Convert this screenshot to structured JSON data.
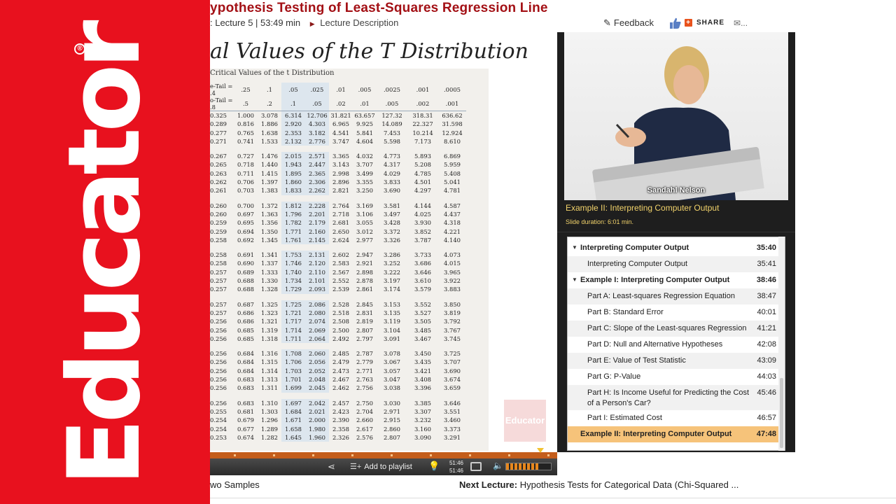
{
  "brand": {
    "name": "Educator",
    "reg_mark": "®"
  },
  "header": {
    "title": "ypothesis Testing of Least-Squares Regression Line",
    "lecture_info": ": Lecture 5 | 53:49 min",
    "lecture_description": "Lecture Description",
    "feedback": "Feedback",
    "share": "SHARE",
    "mail_more": "..."
  },
  "slide": {
    "title": "al Values of the T Distribution",
    "table_caption": "Critical Values of the t Distribution",
    "header_row1": [
      "e-Tail = .4",
      ".25",
      ".1",
      ".05",
      ".025",
      ".01",
      ".005",
      ".0025",
      ".001",
      ".0005"
    ],
    "header_row2": [
      "o-Tail = .8",
      ".5",
      ".2",
      ".1",
      ".05",
      ".02",
      ".01",
      ".005",
      ".002",
      ".001"
    ],
    "groups": [
      [
        [
          "0.325",
          "1.000",
          "3.078",
          "6.314",
          "12.706",
          "31.821",
          "63.657",
          "127.32",
          "318.31",
          "636.62"
        ],
        [
          "0.289",
          "0.816",
          "1.886",
          "2.920",
          "4.303",
          "6.965",
          "9.925",
          "14.089",
          "22.327",
          "31.598"
        ],
        [
          "0.277",
          "0.765",
          "1.638",
          "2.353",
          "3.182",
          "4.541",
          "5.841",
          "7.453",
          "10.214",
          "12.924"
        ],
        [
          "0.271",
          "0.741",
          "1.533",
          "2.132",
          "2.776",
          "3.747",
          "4.604",
          "5.598",
          "7.173",
          "8.610"
        ]
      ],
      [
        [
          "0.267",
          "0.727",
          "1.476",
          "2.015",
          "2.571",
          "3.365",
          "4.032",
          "4.773",
          "5.893",
          "6.869"
        ],
        [
          "0.265",
          "0.718",
          "1.440",
          "1.943",
          "2.447",
          "3.143",
          "3.707",
          "4.317",
          "5.208",
          "5.959"
        ],
        [
          "0.263",
          "0.711",
          "1.415",
          "1.895",
          "2.365",
          "2.998",
          "3.499",
          "4.029",
          "4.785",
          "5.408"
        ],
        [
          "0.262",
          "0.706",
          "1.397",
          "1.860",
          "2.306",
          "2.896",
          "3.355",
          "3.833",
          "4.501",
          "5.041"
        ],
        [
          "0.261",
          "0.703",
          "1.383",
          "1.833",
          "2.262",
          "2.821",
          "3.250",
          "3.690",
          "4.297",
          "4.781"
        ]
      ],
      [
        [
          "0.260",
          "0.700",
          "1.372",
          "1.812",
          "2.228",
          "2.764",
          "3.169",
          "3.581",
          "4.144",
          "4.587"
        ],
        [
          "0.260",
          "0.697",
          "1.363",
          "1.796",
          "2.201",
          "2.718",
          "3.106",
          "3.497",
          "4.025",
          "4.437"
        ],
        [
          "0.259",
          "0.695",
          "1.356",
          "1.782",
          "2.179",
          "2.681",
          "3.055",
          "3.428",
          "3.930",
          "4.318"
        ],
        [
          "0.259",
          "0.694",
          "1.350",
          "1.771",
          "2.160",
          "2.650",
          "3.012",
          "3.372",
          "3.852",
          "4.221"
        ],
        [
          "0.258",
          "0.692",
          "1.345",
          "1.761",
          "2.145",
          "2.624",
          "2.977",
          "3.326",
          "3.787",
          "4.140"
        ]
      ],
      [
        [
          "0.258",
          "0.691",
          "1.341",
          "1.753",
          "2.131",
          "2.602",
          "2.947",
          "3.286",
          "3.733",
          "4.073"
        ],
        [
          "0.258",
          "0.690",
          "1.337",
          "1.746",
          "2.120",
          "2.583",
          "2.921",
          "3.252",
          "3.686",
          "4.015"
        ],
        [
          "0.257",
          "0.689",
          "1.333",
          "1.740",
          "2.110",
          "2.567",
          "2.898",
          "3.222",
          "3.646",
          "3.965"
        ],
        [
          "0.257",
          "0.688",
          "1.330",
          "1.734",
          "2.101",
          "2.552",
          "2.878",
          "3.197",
          "3.610",
          "3.922"
        ],
        [
          "0.257",
          "0.688",
          "1.328",
          "1.729",
          "2.093",
          "2.539",
          "2.861",
          "3.174",
          "3.579",
          "3.883"
        ]
      ],
      [
        [
          "0.257",
          "0.687",
          "1.325",
          "1.725",
          "2.086",
          "2.528",
          "2.845",
          "3.153",
          "3.552",
          "3.850"
        ],
        [
          "0.257",
          "0.686",
          "1.323",
          "1.721",
          "2.080",
          "2.518",
          "2.831",
          "3.135",
          "3.527",
          "3.819"
        ],
        [
          "0.256",
          "0.686",
          "1.321",
          "1.717",
          "2.074",
          "2.508",
          "2.819",
          "3.119",
          "3.505",
          "3.792"
        ],
        [
          "0.256",
          "0.685",
          "1.319",
          "1.714",
          "2.069",
          "2.500",
          "2.807",
          "3.104",
          "3.485",
          "3.767"
        ],
        [
          "0.256",
          "0.685",
          "1.318",
          "1.711",
          "2.064",
          "2.492",
          "2.797",
          "3.091",
          "3.467",
          "3.745"
        ]
      ],
      [
        [
          "0.256",
          "0.684",
          "1.316",
          "1.708",
          "2.060",
          "2.485",
          "2.787",
          "3.078",
          "3.450",
          "3.725"
        ],
        [
          "0.256",
          "0.684",
          "1.315",
          "1.706",
          "2.056",
          "2.479",
          "2.779",
          "3.067",
          "3.435",
          "3.707"
        ],
        [
          "0.256",
          "0.684",
          "1.314",
          "1.703",
          "2.052",
          "2.473",
          "2.771",
          "3.057",
          "3.421",
          "3.690"
        ],
        [
          "0.256",
          "0.683",
          "1.313",
          "1.701",
          "2.048",
          "2.467",
          "2.763",
          "3.047",
          "3.408",
          "3.674"
        ],
        [
          "0.256",
          "0.683",
          "1.311",
          "1.699",
          "2.045",
          "2.462",
          "2.756",
          "3.038",
          "3.396",
          "3.659"
        ]
      ],
      [
        [
          "0.256",
          "0.683",
          "1.310",
          "1.697",
          "2.042",
          "2.457",
          "2.750",
          "3.030",
          "3.385",
          "3.646"
        ],
        [
          "0.255",
          "0.681",
          "1.303",
          "1.684",
          "2.021",
          "2.423",
          "2.704",
          "2.971",
          "3.307",
          "3.551"
        ],
        [
          "0.254",
          "0.679",
          "1.296",
          "1.671",
          "2.000",
          "2.390",
          "2.660",
          "2.915",
          "3.232",
          "3.460"
        ],
        [
          "0.254",
          "0.677",
          "1.289",
          "1.658",
          "1.980",
          "2.358",
          "2.617",
          "2.860",
          "3.160",
          "3.373"
        ],
        [
          "0.253",
          "0.674",
          "1.282",
          "1.645",
          "1.960",
          "2.326",
          "2.576",
          "2.807",
          "3.090",
          "3.291"
        ]
      ]
    ],
    "logo_text": "Educator"
  },
  "player": {
    "add_to_playlist": "Add to playlist",
    "time_current": "51:46",
    "time_total": "51:46",
    "volume_level": 0.75
  },
  "footer": {
    "previous": "wo Samples",
    "next_label": "Next Lecture:",
    "next_value": "Hypothesis Tests for Categorical Data (Chi-Squared ..."
  },
  "video": {
    "presenter_name": "Sandahl Nelson",
    "current_slide": "Example II: Interpreting Computer Output",
    "slide_duration": "Slide duration: 6:01 min."
  },
  "outline": [
    {
      "label": "Interpreting Computer Output",
      "time": "35:40",
      "type": "section"
    },
    {
      "label": "Interpreting Computer Output",
      "time": "35:41",
      "type": "item"
    },
    {
      "label": "Example I: Interpreting Computer Output",
      "time": "38:46",
      "type": "section"
    },
    {
      "label": "Part A: Least-squares Regression Equation",
      "time": "38:47",
      "type": "item"
    },
    {
      "label": "Part B: Standard Error",
      "time": "40:01",
      "type": "item"
    },
    {
      "label": "Part C: Slope of the Least-squares Regression",
      "time": "41:21",
      "type": "item"
    },
    {
      "label": "Part D: Null and Alternative Hypotheses",
      "time": "42:08",
      "type": "item"
    },
    {
      "label": "Part E: Value of Test Statistic",
      "time": "43:09",
      "type": "item"
    },
    {
      "label": "Part G: P-Value",
      "time": "44:03",
      "type": "item"
    },
    {
      "label": "Part H: Is Income Useful for Predicting the Cost",
      "label2": "of a Person's Car?",
      "time": "45:46",
      "type": "item"
    },
    {
      "label": "Part I: Estimated Cost",
      "time": "46:57",
      "type": "item"
    },
    {
      "label": "Example II: Interpreting Computer Output",
      "time": "47:48",
      "type": "section",
      "active": true
    }
  ],
  "colors": {
    "brand_red": "#e8111e",
    "title_red": "#a31015",
    "active_row": "#f6c37a",
    "slide_caption_yellow": "#f2d36b"
  }
}
